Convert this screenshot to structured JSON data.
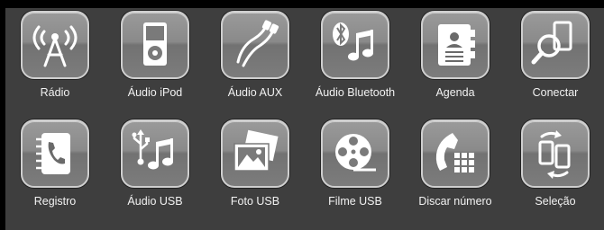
{
  "menu": {
    "items": [
      {
        "id": "radio",
        "label": "Rádio",
        "icon": "radio-antenna-icon"
      },
      {
        "id": "ipod",
        "label": "Áudio iPod",
        "icon": "ipod-icon"
      },
      {
        "id": "aux",
        "label": "Áudio AUX",
        "icon": "aux-cable-icon"
      },
      {
        "id": "bluetooth",
        "label": "Áudio Bluetooth",
        "icon": "bluetooth-music-icon"
      },
      {
        "id": "agenda",
        "label": "Agenda",
        "icon": "phonebook-icon"
      },
      {
        "id": "conectar",
        "label": "Conectar",
        "icon": "search-device-icon"
      },
      {
        "id": "registro",
        "label": "Registro",
        "icon": "call-log-icon"
      },
      {
        "id": "usb-audio",
        "label": "Áudio USB",
        "icon": "usb-music-icon"
      },
      {
        "id": "usb-photo",
        "label": "Foto USB",
        "icon": "photo-icon"
      },
      {
        "id": "usb-movie",
        "label": "Filme USB",
        "icon": "film-reel-icon"
      },
      {
        "id": "dial",
        "label": "Discar número",
        "icon": "dial-keypad-icon"
      },
      {
        "id": "selecao",
        "label": "Seleção",
        "icon": "switch-device-icon"
      }
    ]
  }
}
